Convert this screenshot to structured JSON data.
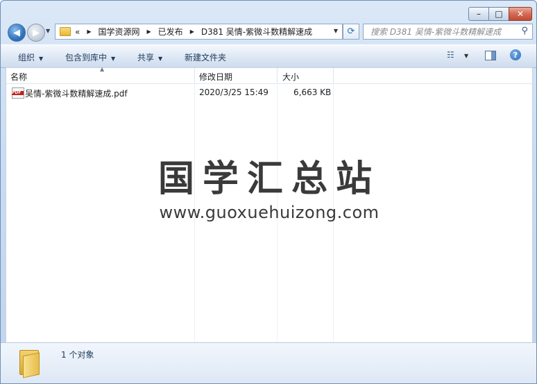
{
  "window": {
    "buttons": {
      "minimize": "–",
      "maximize": "□",
      "close": "✕"
    }
  },
  "nav": {
    "back_icon": "◀",
    "forward_icon": "▶",
    "breadcrumb_prefix": "«",
    "breadcrumbs": [
      "国学资源网",
      "已发布",
      "D381 吴情-紫微斗数精解速成"
    ],
    "refresh_icon": "⟳",
    "search_placeholder": "搜索 D381 吴情-紫微斗数精解速成",
    "search_icon": "⚲"
  },
  "toolbar": {
    "organize": "组织",
    "include_in_library": "包含到库中",
    "share": "共享",
    "new_folder": "新建文件夹",
    "view_icon": "☷",
    "help": "?"
  },
  "columns": {
    "name": "名称",
    "modified": "修改日期",
    "size": "大小"
  },
  "files": [
    {
      "icon": "pdf-icon",
      "icon_text": "PDF",
      "name": "吴情-紫微斗数精解速成.pdf",
      "modified": "2020/3/25 15:49",
      "size": "6,663 KB"
    }
  ],
  "watermark": {
    "title": "国学汇总站",
    "url": "www.guoxuehuizong.com"
  },
  "details": {
    "count": "1 个对象"
  },
  "colors": {
    "accent": "#2f74c2",
    "pdf_red": "#c3201b"
  }
}
